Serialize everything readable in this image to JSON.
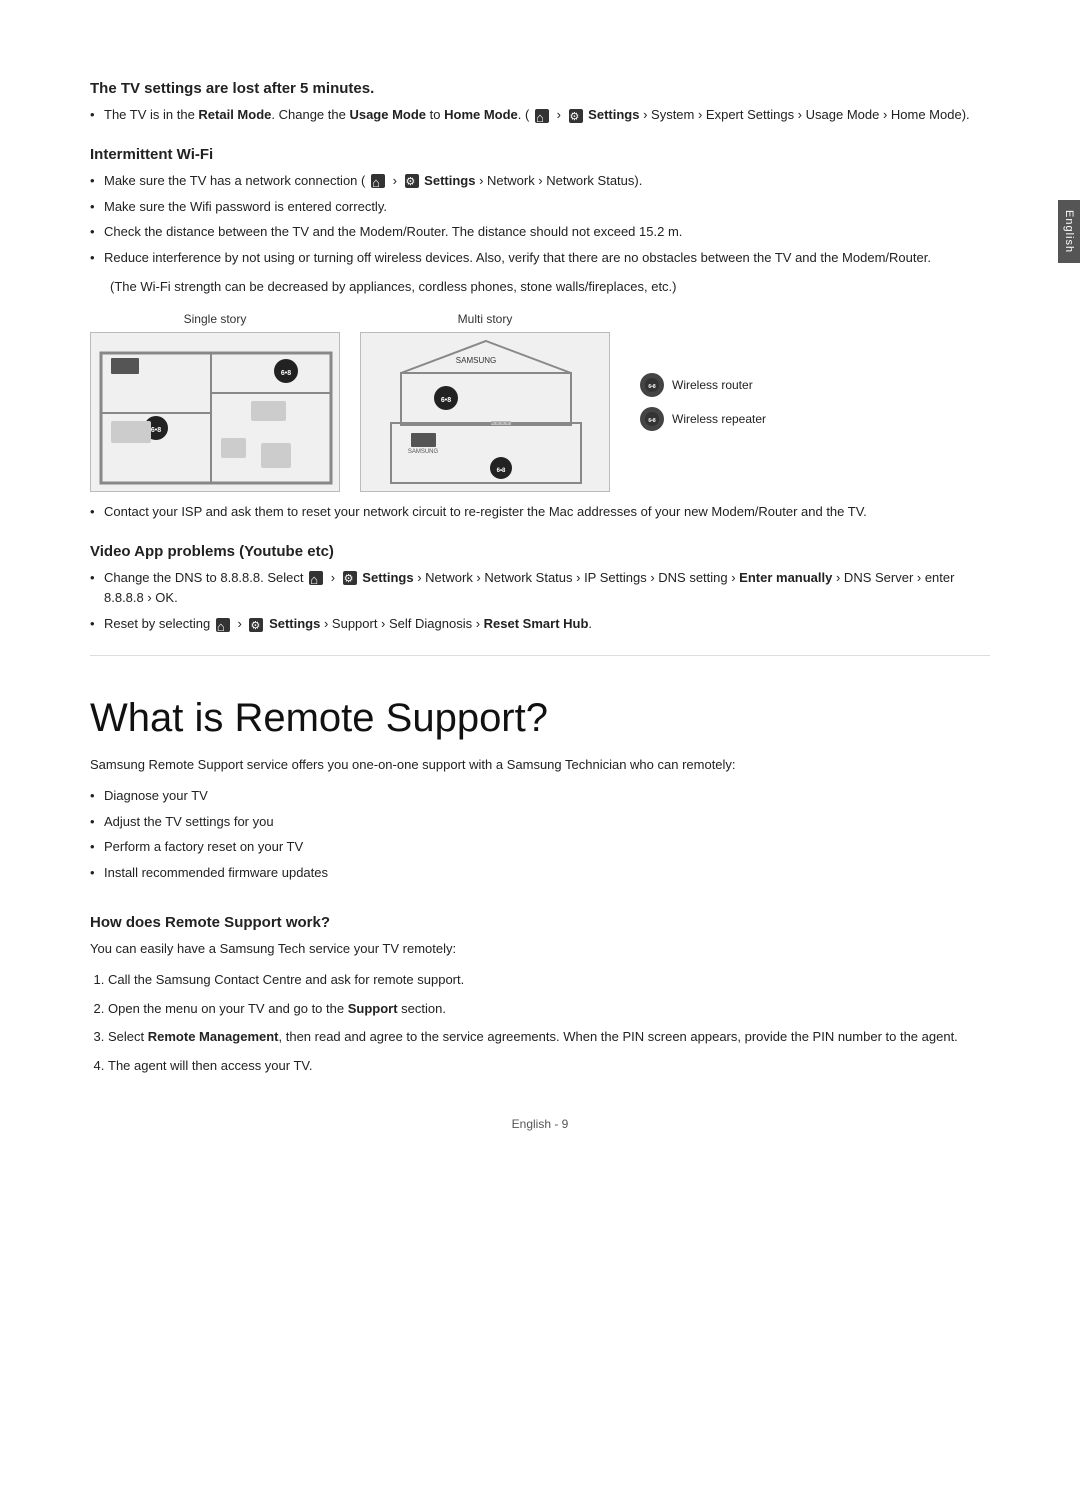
{
  "side_tab": {
    "label": "English"
  },
  "section1": {
    "title": "The TV settings are lost after 5 minutes.",
    "bullet1": "The TV is in the Retail Mode. Change the Usage Mode to Home Mode. ( > Settings > System > Expert Settings > Usage Mode > Home Mode)."
  },
  "section2": {
    "title": "Intermittent Wi-Fi",
    "bullets": [
      "Make sure the TV has a network connection ( > Settings > Network > Network Status).",
      "Make sure the Wifi password is entered correctly.",
      "Check the distance between the TV and the Modem/Router. The distance should not exceed 15.2 m.",
      "Reduce interference by not using or turning off wireless devices. Also, verify that there are no obstacles between the TV and the Modem/Router.",
      "(The Wi-Fi strength can be decreased by appliances, cordless phones, stone walls/fireplaces, etc.)"
    ],
    "diagram_single_label": "Single story",
    "diagram_multi_label": "Multi story",
    "legend_wireless_router": "Wireless router",
    "legend_wireless_repeater": "Wireless repeater",
    "isp_note": "Contact your ISP and ask them to reset your network circuit to re-register the Mac addresses of your new Modem/Router and the TV."
  },
  "section3": {
    "title": "Video App problems (Youtube etc)",
    "bullets": [
      "Change the DNS to 8.8.8.8. Select  > Settings > Network > Network Status > IP Settings > DNS setting > Enter manually > DNS Server > enter 8.8.8.8 > OK.",
      "Reset by selecting  > Settings > Support > Self Diagnosis > Reset Smart Hub."
    ]
  },
  "main_section": {
    "title": "What is Remote Support?",
    "intro": "Samsung Remote Support service offers you one-on-one support with a Samsung Technician who can remotely:",
    "bullets": [
      "Diagnose your TV",
      "Adjust the TV settings for you",
      "Perform a factory reset on your TV",
      "Install recommended firmware updates"
    ]
  },
  "how_section": {
    "title": "How does Remote Support work?",
    "intro": "You can easily have a Samsung Tech service your TV remotely:",
    "steps": [
      "Call the Samsung Contact Centre and ask for remote support.",
      "Open the menu on your TV and go to the Support section.",
      "Select Remote Management, then read and agree to the service agreements. When the PIN screen appears, provide the PIN number to the agent.",
      "The agent will then access your TV."
    ]
  },
  "footer": {
    "label": "English - 9"
  }
}
